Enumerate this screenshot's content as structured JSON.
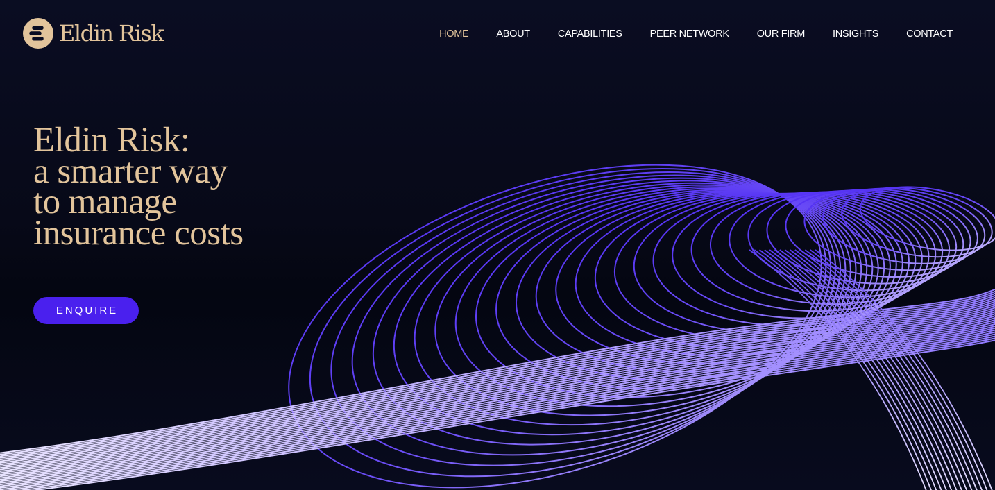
{
  "brand": {
    "name": "Eldin Risk",
    "logo_icon": "stacked-bars-icon",
    "gold": "#e2c49b"
  },
  "nav": {
    "items": [
      {
        "label": "HOME",
        "active": true
      },
      {
        "label": "ABOUT",
        "active": false
      },
      {
        "label": "CAPABILITIES",
        "active": false
      },
      {
        "label": "PEER NETWORK",
        "active": false
      },
      {
        "label": "OUR FIRM",
        "active": false
      },
      {
        "label": "INSIGHTS",
        "active": false
      },
      {
        "label": "CONTACT",
        "active": false
      }
    ]
  },
  "hero": {
    "title_lines": [
      "Eldin Risk:",
      "a smarter way",
      "to manage",
      "insurance costs"
    ],
    "cta_label": "ENQUIRE"
  },
  "theme": {
    "background": "#080b1c",
    "accent": "#4a20ee",
    "wave_primary": "#5b3df5",
    "wave_light": "#ddd5ff"
  }
}
